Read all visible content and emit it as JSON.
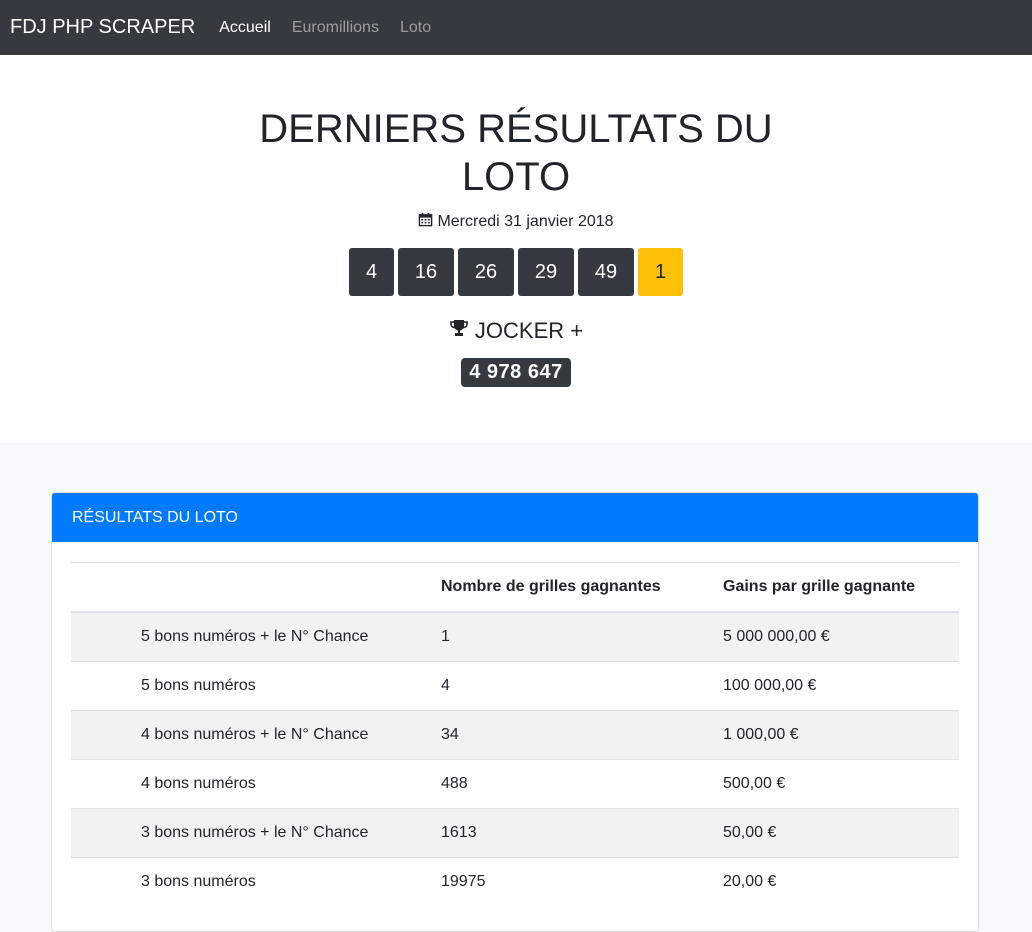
{
  "navbar": {
    "brand": "FDJ PHP SCRAPER",
    "links": [
      "Accueil",
      "Euromillions",
      "Loto"
    ]
  },
  "hero": {
    "title": "DERNIERS RÉSULTATS DU LOTO",
    "date_icon": "calendar-icon",
    "date": "Mercredi 31 janvier 2018",
    "numbers": [
      "4",
      "16",
      "26",
      "29",
      "49"
    ],
    "chance_number": "1",
    "jocker_icon": "trophy-icon",
    "jocker_label": "JOCKER +",
    "jocker_number": "4 978 647"
  },
  "card": {
    "title": "RÉSULTATS DU LOTO",
    "headers": [
      "",
      "Nombre de grilles gagnantes",
      "Gains par grille gagnante"
    ],
    "rows": [
      [
        "5 bons numéros + le N° Chance",
        "1",
        "5 000 000,00 €"
      ],
      [
        "5 bons numéros",
        "4",
        "100 000,00 €"
      ],
      [
        "4 bons numéros + le N° Chance",
        "34",
        "1 000,00 €"
      ],
      [
        "4 bons numéros",
        "488",
        "500,00 €"
      ],
      [
        "3 bons numéros + le N° Chance",
        "1613",
        "50,00 €"
      ],
      [
        "3 bons numéros",
        "19975",
        "20,00 €"
      ]
    ]
  },
  "colors": {
    "navbar": "#343a40",
    "card_header": "#007bff",
    "chance_ball": "#ffc107",
    "number_ball": "#343a40"
  }
}
